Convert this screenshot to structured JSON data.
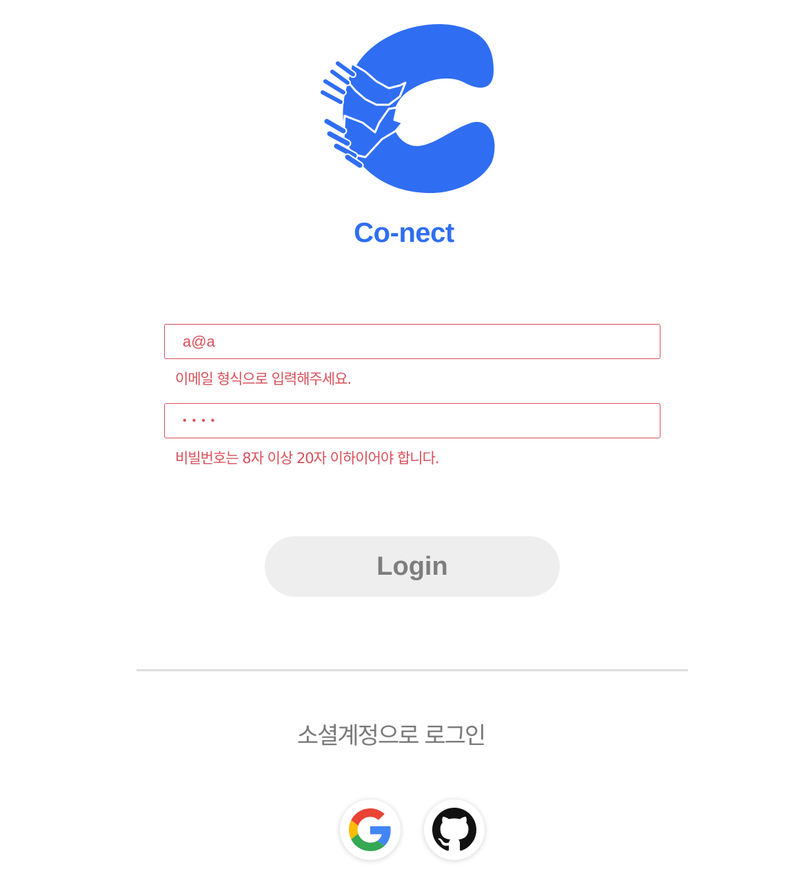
{
  "brand": {
    "name": "Co-nect",
    "color": "#2f6ef3"
  },
  "form": {
    "email_value": "a@a",
    "email_error": "이메일 형식으로 입력해주세요.",
    "password_value": "••••",
    "password_error": "비빌번호는 8자 이상 20자 이하이어야 합니다.",
    "error_color": "#d9505a"
  },
  "login_button": {
    "label": "Login"
  },
  "social": {
    "title": "소셜계정으로 로그인",
    "providers": [
      {
        "name": "google",
        "icon": "google-icon"
      },
      {
        "name": "github",
        "icon": "github-icon"
      }
    ]
  }
}
